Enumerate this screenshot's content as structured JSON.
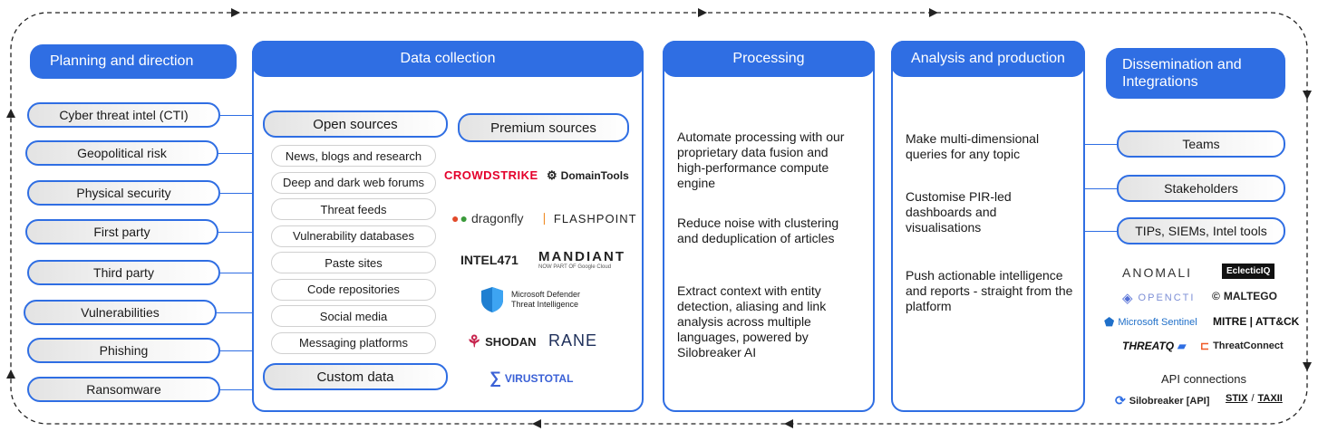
{
  "columns": {
    "planning": {
      "title": "Planning and direction",
      "items": [
        "Cyber threat intel (CTI)",
        "Geopolitical risk",
        "Physical security",
        "First party",
        "Third party",
        "Vulnerabilities",
        "Phishing",
        "Ransomware"
      ]
    },
    "collection": {
      "title": "Data collection",
      "open_sources": "Open sources",
      "open_items": [
        "News, blogs and research",
        "Deep and dark web forums",
        "Threat feeds",
        "Vulnerability databases",
        "Paste sites",
        "Code repositories",
        "Social media",
        "Messaging platforms"
      ],
      "custom_data": "Custom data",
      "premium_sources": "Premium sources",
      "premium_logos": [
        "CROWDSTRIKE",
        "DomainTools",
        "dragonfly",
        "FLASHPOINT",
        "INTEL471",
        "MANDIANT",
        "Microsoft Defender",
        "Threat Intelligence",
        "SHODAN",
        "RANE",
        "VIRUSTOTAL"
      ],
      "mandiant_sub": "NOW PART OF Google Cloud"
    },
    "processing": {
      "title": "Processing",
      "paragraphs": [
        "Automate processing with our proprietary data fusion and high-performance compute engine",
        "Reduce noise with clustering and deduplication of articles",
        "Extract context with entity detection, aliasing and link analysis across multiple languages, powered by Silobreaker AI"
      ]
    },
    "analysis": {
      "title": "Analysis and production",
      "paragraphs": [
        "Make multi-dimensional queries for any topic",
        "Customise PIR-led dashboards and visualisations",
        "Push actionable intelligence and reports - straight from the platform"
      ]
    },
    "dissemination": {
      "title_line1": "Dissemination and",
      "title_line2": "Integrations",
      "items": [
        "Teams",
        "Stakeholders",
        "TIPs, SIEMs, Intel tools"
      ],
      "logos": [
        "ANOMALI",
        "EclecticIQ",
        "OPENCTI",
        "MALTEGO",
        "Microsoft Sentinel",
        "MITRE | ATT&CK",
        "THREATQ",
        "ThreatConnect"
      ],
      "api_label": "API connections",
      "api_logos": [
        "Silobreaker [API]",
        "STIX",
        "TAXII"
      ]
    }
  },
  "colors": {
    "accent": "#2f6ee3",
    "frame": "#222222"
  }
}
